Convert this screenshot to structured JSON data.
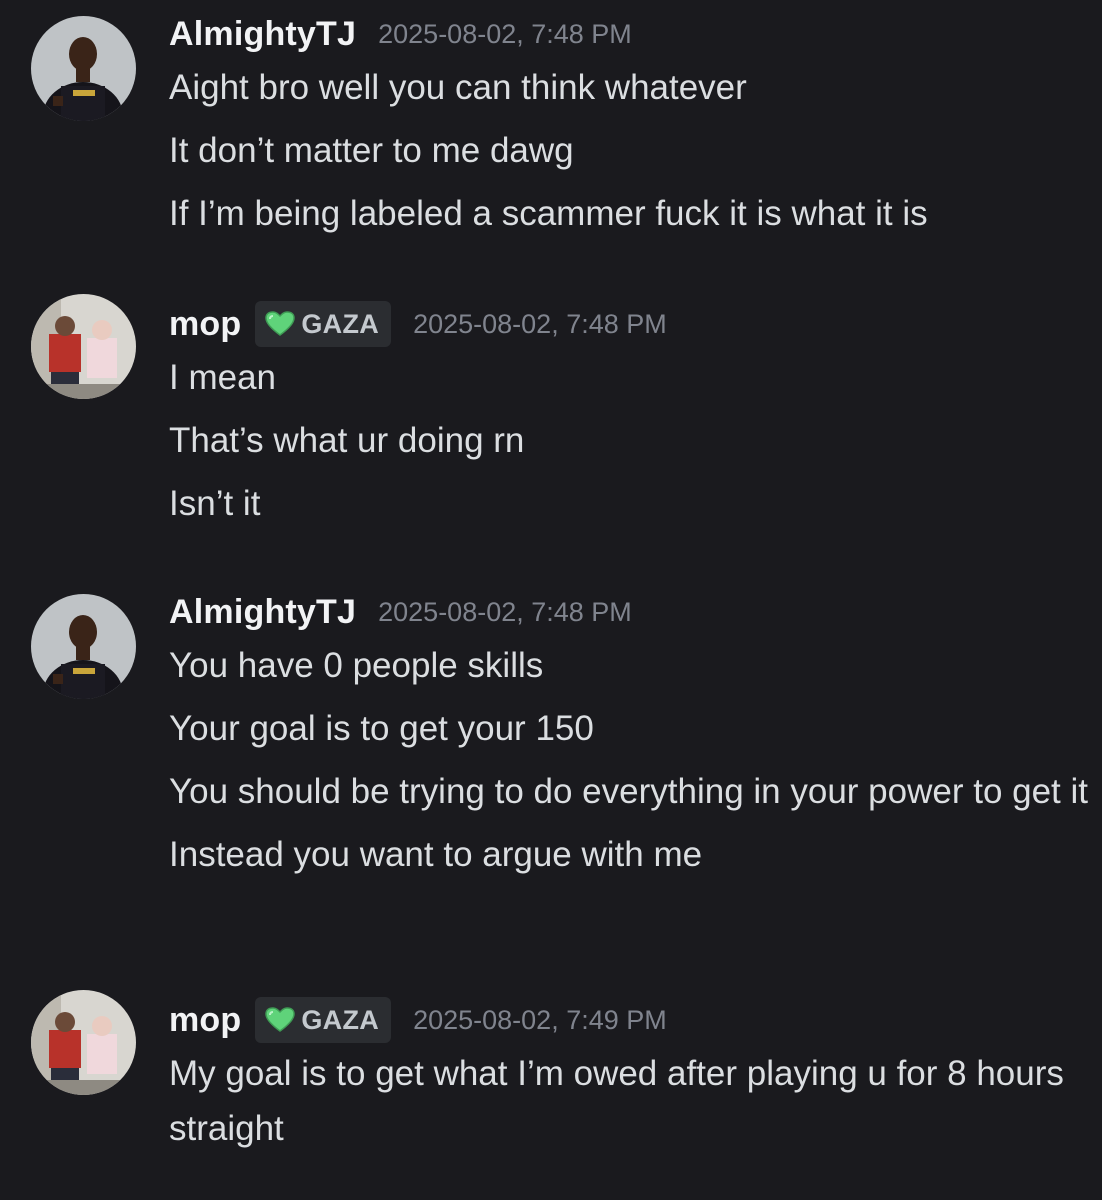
{
  "messages": [
    {
      "username": "AlmightyTJ",
      "tag": "",
      "timestamp": "2025-08-02, 7:48 PM",
      "lines": [
        "Aight bro well you can think whatever",
        "It don’t matter to me dawg",
        "If I’m being labeled a scammer fuck it is what it is"
      ]
    },
    {
      "username": "mop",
      "tag": "GAZA",
      "timestamp": "2025-08-02, 7:48 PM",
      "lines": [
        "I mean",
        "That’s what ur doing rn",
        "Isn’t it"
      ]
    },
    {
      "username": "AlmightyTJ",
      "tag": "",
      "timestamp": "2025-08-02, 7:48 PM",
      "lines": [
        "You have 0 people skills",
        "Your goal is to get your 150",
        "You should be trying to do everything in your power to get it",
        "Instead you want to argue with me"
      ]
    },
    {
      "username": "mop",
      "tag": "GAZA",
      "timestamp": "2025-08-02, 7:49 PM",
      "lines": [
        "My goal is to get what I’m owed after playing u for 8 hours straight"
      ]
    }
  ],
  "icons": {
    "tag_icon": "green-heart-icon",
    "avatar_tj": "avatar-person-in-jersey",
    "avatar_mop": "avatar-two-children-photo"
  },
  "colors": {
    "background": "#1a1a1e",
    "username": "#f2f3f5",
    "message_text": "#dbdee1",
    "timestamp": "#80848e",
    "tag_background": "#2b2d31",
    "heart_green": "#5fd37a"
  }
}
